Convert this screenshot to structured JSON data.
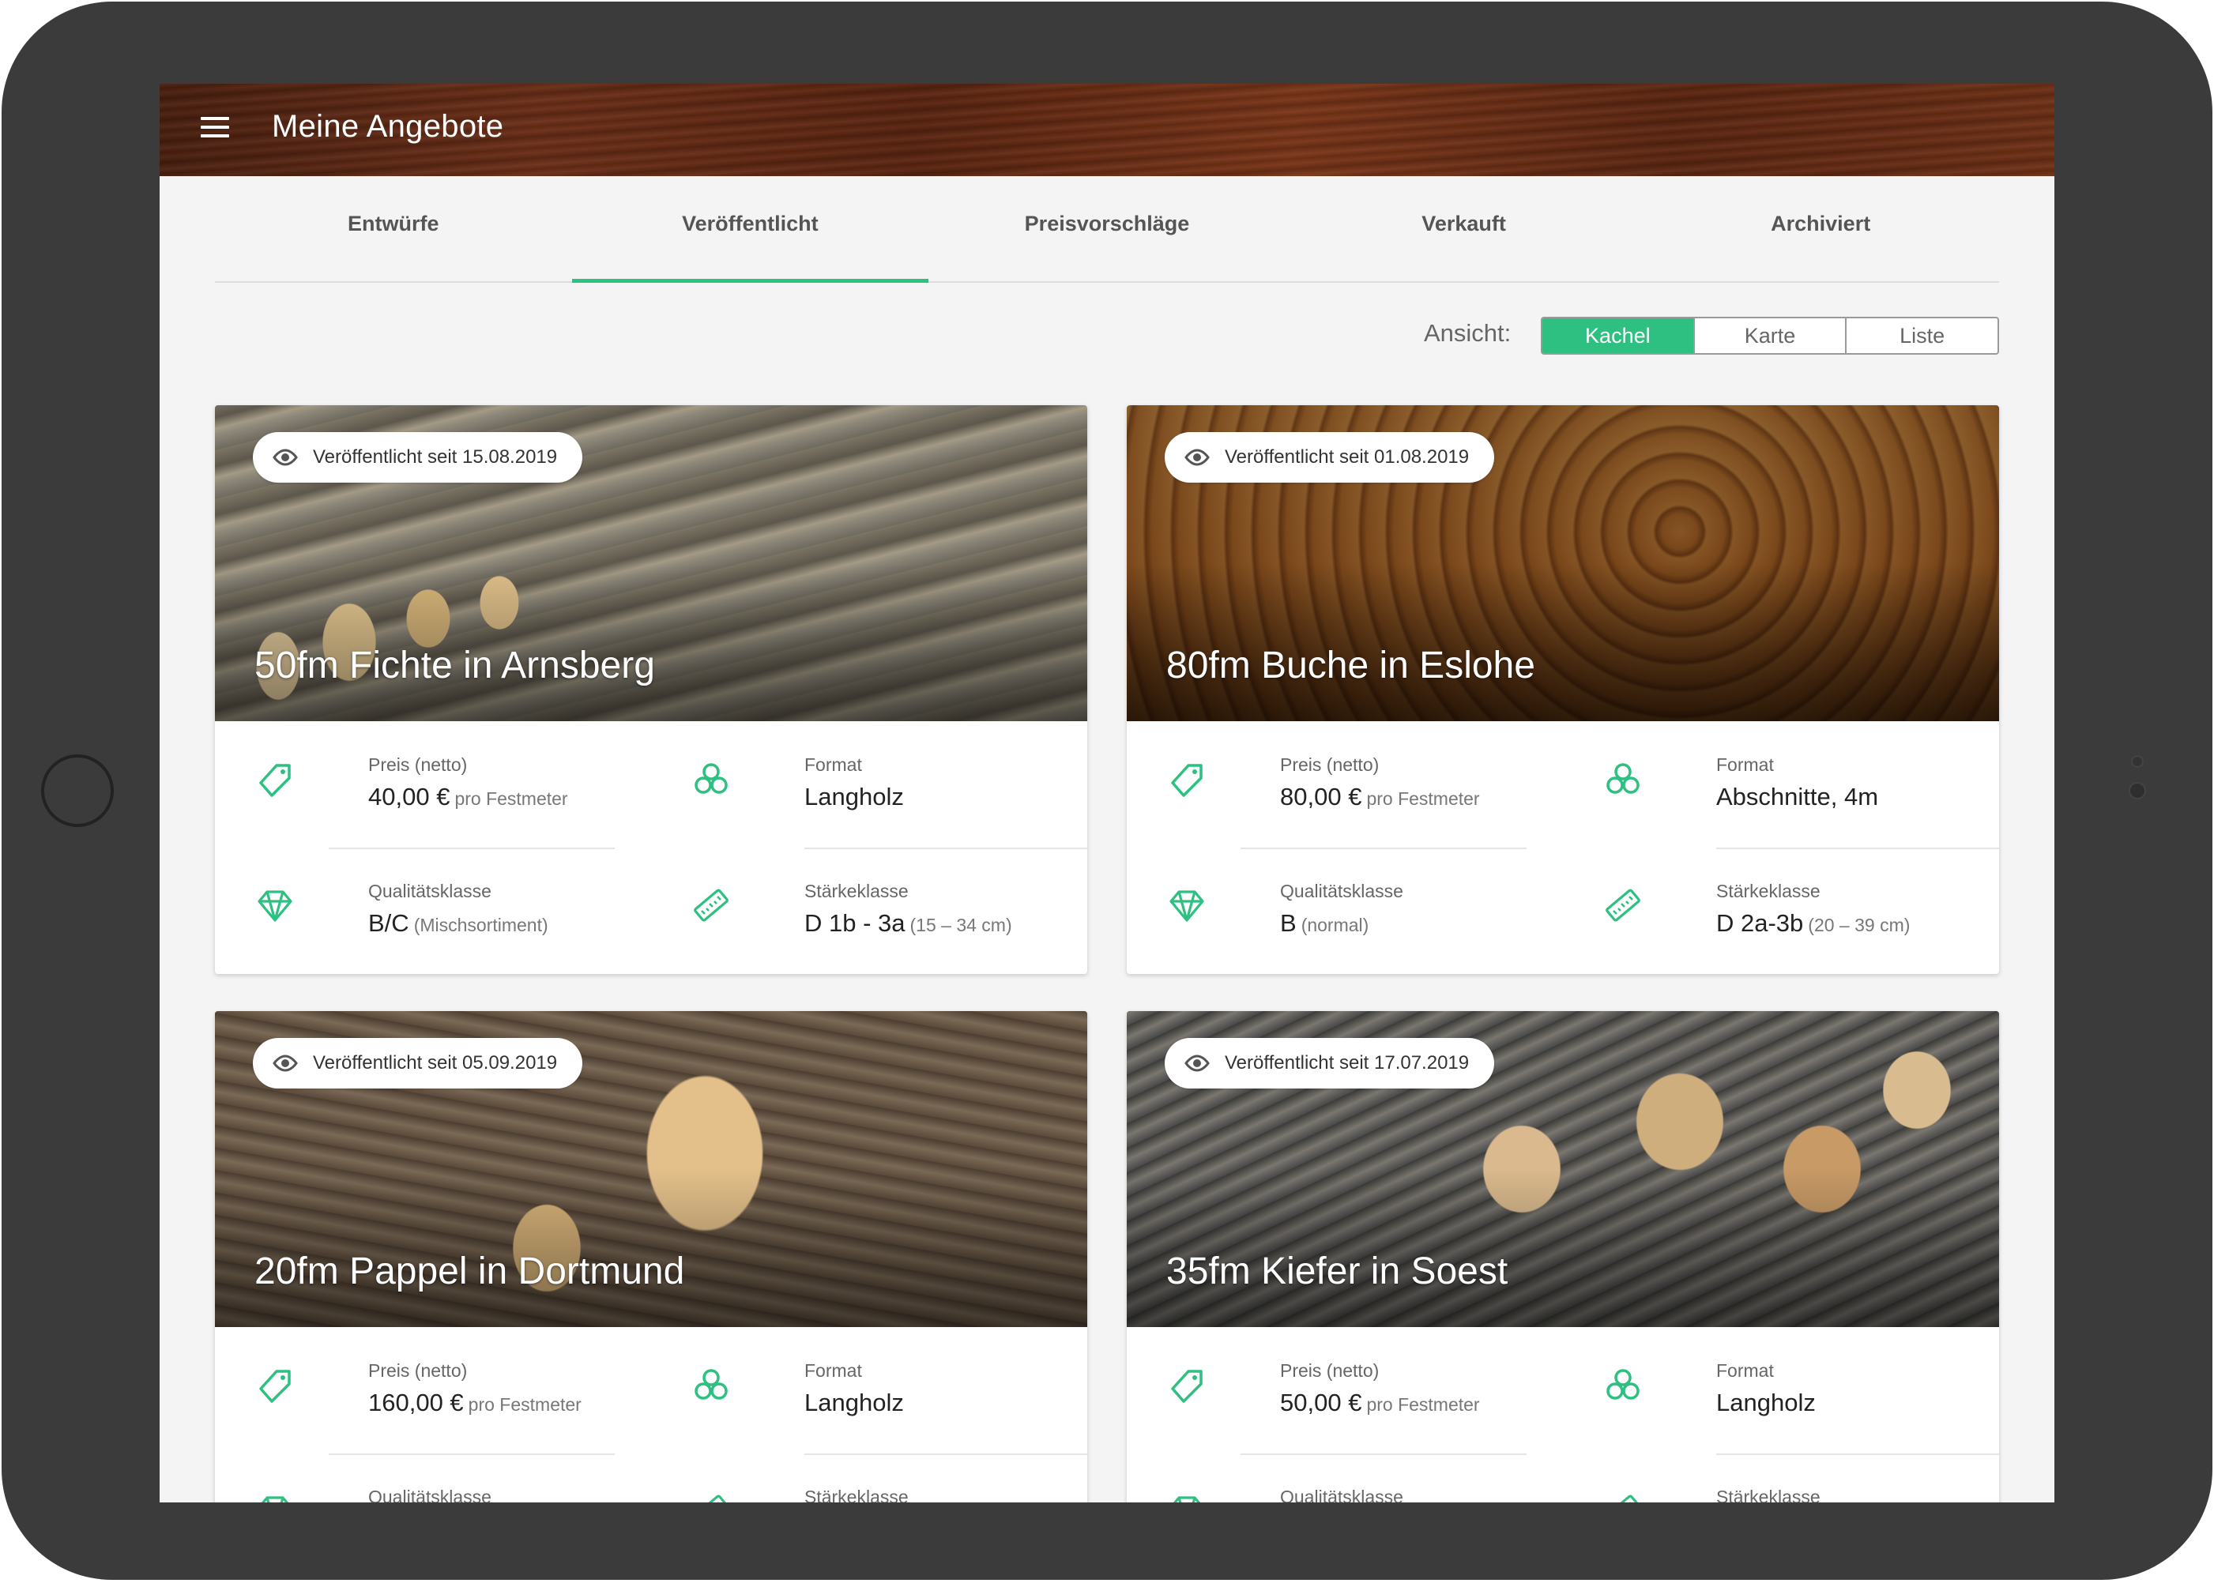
{
  "app": {
    "title": "Meine Angebote"
  },
  "tabs": [
    {
      "label": "Entwürfe"
    },
    {
      "label": "Veröffentlicht"
    },
    {
      "label": "Preisvorschläge"
    },
    {
      "label": "Verkauft"
    },
    {
      "label": "Archiviert"
    }
  ],
  "active_tab": "Veröffentlicht",
  "view": {
    "label": "Ansicht:",
    "options": [
      "Kachel",
      "Karte",
      "Liste"
    ],
    "selected": "Kachel"
  },
  "colors": {
    "accent": "#2dc080",
    "appbar": "#6b2e17"
  },
  "cards": [
    {
      "badge": "Veröffentlicht seit 15.08.2019",
      "title": "50fm Fichte in Arnsberg",
      "price_label": "Preis (netto)",
      "price_value": "40,00 €",
      "price_unit": "pro Festmeter",
      "format_label": "Format",
      "format_value": "Langholz",
      "quality_label": "Qualitätsklasse",
      "quality_value": "B/C",
      "quality_sub": "(Mischsortiment)",
      "strength_label": "Stärkeklasse",
      "strength_value": "D 1b - 3a",
      "strength_sub": "(15 – 34 cm)"
    },
    {
      "badge": "Veröffentlicht seit 01.08.2019",
      "title": "80fm Buche in Eslohe",
      "price_label": "Preis (netto)",
      "price_value": "80,00 €",
      "price_unit": "pro Festmeter",
      "format_label": "Format",
      "format_value": "Abschnitte, 4m",
      "quality_label": "Qualitätsklasse",
      "quality_value": "B",
      "quality_sub": "(normal)",
      "strength_label": "Stärkeklasse",
      "strength_value": "D 2a-3b",
      "strength_sub": "(20 – 39 cm)"
    },
    {
      "badge": "Veröffentlicht seit 05.09.2019",
      "title": "20fm Pappel in Dortmund",
      "price_label": "Preis (netto)",
      "price_value": "160,00 €",
      "price_unit": "pro Festmeter",
      "format_label": "Format",
      "format_value": "Langholz",
      "quality_label": "Qualitätsklasse",
      "strength_label": "Stärkeklasse"
    },
    {
      "badge": "Veröffentlicht seit 17.07.2019",
      "title": "35fm Kiefer in Soest",
      "price_label": "Preis (netto)",
      "price_value": "50,00 €",
      "price_unit": "pro Festmeter",
      "format_label": "Format",
      "format_value": "Langholz",
      "quality_label": "Qualitätsklasse",
      "strength_label": "Stärkeklasse"
    }
  ]
}
